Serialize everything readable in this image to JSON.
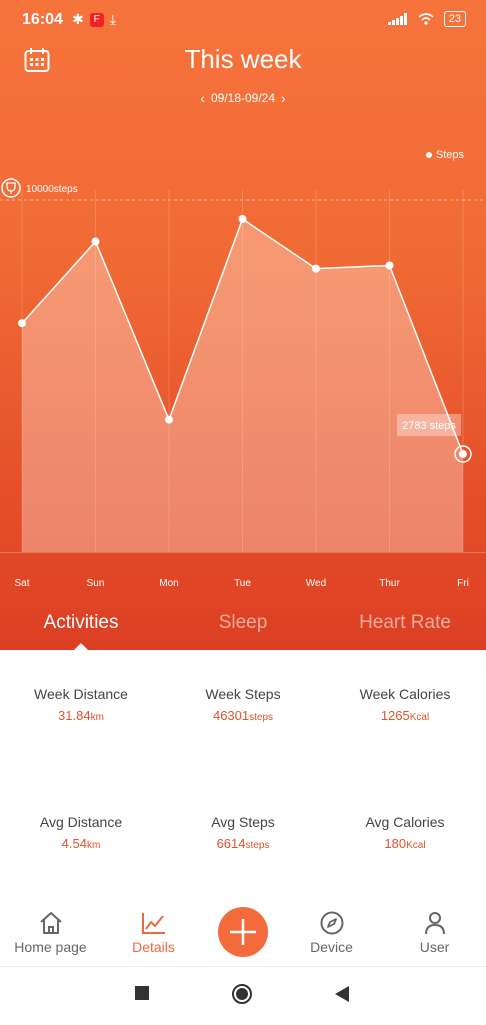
{
  "status_bar": {
    "time": "16:04",
    "battery": "23"
  },
  "header": {
    "title": "This week",
    "date_range": "09/18-09/24"
  },
  "chart_data": {
    "type": "area",
    "categories": [
      "Sat",
      "Sun",
      "Mon",
      "Tue",
      "Wed",
      "Thur",
      "Fri"
    ],
    "series": [
      {
        "name": "Steps",
        "values": [
          6500,
          8820,
          3760,
          9460,
          8050,
          8140,
          2783
        ]
      }
    ],
    "goal_label": "10000steps",
    "goal": 10000,
    "highlight_label": "2783 steps",
    "ylim": [
      0,
      11000
    ]
  },
  "tabs": [
    "Activities",
    "Sleep",
    "Heart Rate"
  ],
  "stats": [
    {
      "label": "Week Distance",
      "value": "31.84",
      "unit": "km"
    },
    {
      "label": "Week Steps",
      "value": "46301",
      "unit": "steps"
    },
    {
      "label": "Week Calories",
      "value": "1265",
      "unit": "Kcal"
    },
    {
      "label": "Avg Distance",
      "value": "4.54",
      "unit": "km"
    },
    {
      "label": "Avg Steps",
      "value": "6614",
      "unit": "steps"
    },
    {
      "label": "Avg Calories",
      "value": "180",
      "unit": "Kcal"
    }
  ],
  "nav": {
    "home": "Home page",
    "details": "Details",
    "device": "Device",
    "user": "User"
  },
  "colors": {
    "accent": "#f36b3c",
    "value_text": "#e0522d"
  }
}
